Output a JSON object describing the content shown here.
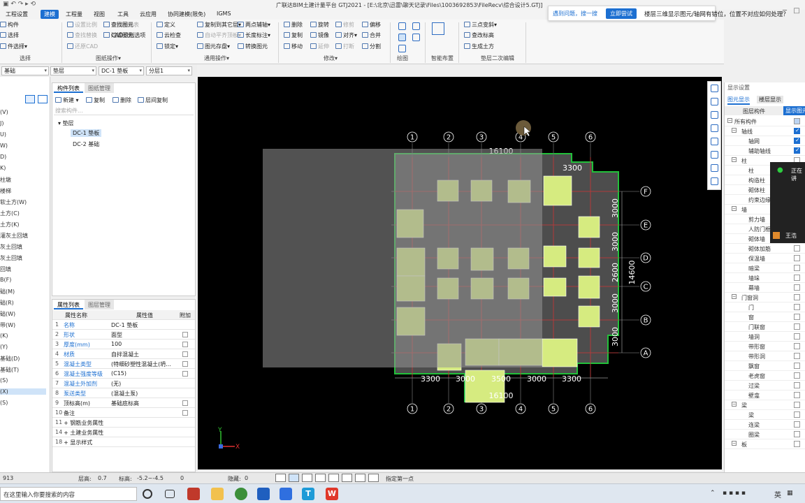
{
  "window": {
    "title": "广联达BIM土建计量平台 GTJ2021 - [E:\\北京\\迅雷\\聊天记录\\Files\\1003692853\\FileRecv\\综合设计5.GTJ]"
  },
  "menu": {
    "items": [
      "工程设置",
      "建模",
      "工程量",
      "视图",
      "工具",
      "云应用",
      "协同建模(限免)",
      "IGMS"
    ],
    "active": "建模"
  },
  "ribbon": {
    "groups": [
      {
        "label": "选择",
        "items": [
          "构件",
          "选择",
          "件选择▾"
        ]
      },
      {
        "label": "图纸操作▾",
        "items": [
          "设置比例",
          "查找替换",
          "还原CAD",
          "识别楼层表",
          "CAD识别选项",
          "查找图元",
          "过滤图元"
        ]
      },
      {
        "label": "通用操作▾",
        "items": [
          "定义",
          "云检查",
          "锁定▾",
          "复制到其它层▾",
          "自动平齐顶板▾",
          "图元存盘▾",
          "两点辅轴▾",
          "长度标注▾",
          "转换图元"
        ]
      },
      {
        "label": "修改▾",
        "items": [
          "删除",
          "复制",
          "移动",
          "旋转",
          "镜像",
          "延伸",
          "修剪",
          "对齐▾",
          "打断",
          "偏移",
          "合并",
          "分割"
        ]
      },
      {
        "label": "绘图",
        "items": []
      },
      {
        "label": "智能布置",
        "items": []
      },
      {
        "label": "垫层二次编辑",
        "items": [
          "三点变斜▾",
          "查改标高",
          "生成土方"
        ]
      }
    ]
  },
  "tip": {
    "question": "遇到问题，搜一搜",
    "button": "立即尝试"
  },
  "help_question": "楼层三维显示图元/轴网有错位，位置不对应如何处理？",
  "selectors": {
    "category": "基础",
    "type": "垫层",
    "component": "DC-1 垫板",
    "layer": "分层1"
  },
  "left_strip": [
    "(V)",
    "J)",
    "U)",
    "W)",
    "D)",
    "K)",
    "柱墩",
    "楼梯",
    "软土方(W)",
    "土方(C)",
    "土方(K)",
    "灌灰土回填",
    "灰土回填",
    "灰土回填",
    "回填",
    "B(F)",
    "础(M)",
    "础(R)",
    "础(W)",
    "带(W)",
    "(K)",
    "(Y)",
    "基础(D)",
    "基础(T)",
    "(S)",
    "(X)",
    "(S)"
  ],
  "component_panel": {
    "tabs": [
      "构件列表",
      "图纸管理"
    ],
    "toolbar": [
      "新建 ▾",
      "复制",
      "删除",
      "层间复制"
    ],
    "search_placeholder": "搜索构件...",
    "tree_root": "垫层",
    "items": [
      {
        "name": "DC-1 垫板",
        "selected": true
      },
      {
        "name": "DC-2 基础",
        "selected": false
      }
    ]
  },
  "property_panel": {
    "tabs": [
      "属性列表",
      "图层管理"
    ],
    "headers": [
      "属性名称",
      "属性值",
      "附加"
    ],
    "rows": [
      {
        "n": "1",
        "k": "名称",
        "v": "DC-1 垫板",
        "blue": true,
        "cb": false
      },
      {
        "n": "2",
        "k": "形状",
        "v": "面型",
        "blue": true,
        "cb": true
      },
      {
        "n": "3",
        "k": "厚度(mm)",
        "v": "100",
        "blue": true,
        "cb": true
      },
      {
        "n": "4",
        "k": "材质",
        "v": "自拌混凝土",
        "blue": true,
        "cb": true
      },
      {
        "n": "5",
        "k": "混凝土类型",
        "v": "(特细砂塑性混凝土(坍...",
        "blue": true,
        "cb": true
      },
      {
        "n": "6",
        "k": "混凝土强度等级",
        "v": "(C15)",
        "blue": true,
        "cb": true
      },
      {
        "n": "7",
        "k": "混凝土外加剂",
        "v": "(无)",
        "blue": true,
        "cb": false
      },
      {
        "n": "8",
        "k": "泵送类型",
        "v": "(混凝土泵)",
        "blue": true,
        "cb": false
      },
      {
        "n": "9",
        "k": "顶标高(m)",
        "v": "基础底标高",
        "blue": false,
        "cb": true
      },
      {
        "n": "10",
        "k": "备注",
        "v": "",
        "blue": false,
        "cb": true
      },
      {
        "n": "11",
        "k": "+ 钢筋业务属性",
        "v": "",
        "blue": false,
        "cb": false
      },
      {
        "n": "14",
        "k": "+ 土建业务属性",
        "v": "",
        "blue": false,
        "cb": false
      },
      {
        "n": "18",
        "k": "+ 显示样式",
        "v": "",
        "blue": false,
        "cb": false
      }
    ]
  },
  "canvas": {
    "axis_numbers": [
      "1",
      "2",
      "3",
      "4",
      "5",
      "6"
    ],
    "axis_letters": [
      "F",
      "E",
      "D",
      "C",
      "B",
      "A"
    ],
    "dims_top": [
      "16100",
      "3300"
    ],
    "dims_bottom": [
      "3300",
      "3000",
      "3500",
      "3000",
      "3300"
    ],
    "dims_bottom_total": "16100",
    "dims_right": [
      "3000",
      "3000",
      "2600",
      "3000",
      "3000"
    ],
    "dims_right_total": "14600",
    "ucs": {
      "x": "X",
      "y": "Y"
    }
  },
  "right_panel": {
    "title": "显示设置",
    "tabs": [
      "图元显示",
      "楼层显示"
    ],
    "headers": [
      "图层构件",
      "显示图元"
    ],
    "rows": [
      {
        "label": "所有构件",
        "indent": 0,
        "group": true,
        "check": "partial"
      },
      {
        "label": "轴线",
        "indent": 1,
        "group": true,
        "check": "on"
      },
      {
        "label": "轴网",
        "indent": 2,
        "group": false,
        "check": "on"
      },
      {
        "label": "辅助轴线",
        "indent": 2,
        "group": false,
        "check": "on"
      },
      {
        "label": "柱",
        "indent": 1,
        "group": true,
        "check": "off"
      },
      {
        "label": "柱",
        "indent": 2,
        "group": false,
        "check": "off"
      },
      {
        "label": "构造柱",
        "indent": 2,
        "group": false,
        "check": "off"
      },
      {
        "label": "砌体柱",
        "indent": 2,
        "group": false,
        "check": "off"
      },
      {
        "label": "约束边缘非...",
        "indent": 2,
        "group": false,
        "check": "off"
      },
      {
        "label": "墙",
        "indent": 1,
        "group": true,
        "check": "off"
      },
      {
        "label": "剪力墙",
        "indent": 2,
        "group": false,
        "check": "off"
      },
      {
        "label": "人防门框墙",
        "indent": 2,
        "group": false,
        "check": "off"
      },
      {
        "label": "砌体墙",
        "indent": 2,
        "group": false,
        "check": "off"
      },
      {
        "label": "砌体加筋",
        "indent": 2,
        "group": false,
        "check": "off"
      },
      {
        "label": "保温墙",
        "indent": 2,
        "group": false,
        "check": "off"
      },
      {
        "label": "暗梁",
        "indent": 2,
        "group": false,
        "check": "off"
      },
      {
        "label": "墙垛",
        "indent": 2,
        "group": false,
        "check": "off"
      },
      {
        "label": "幕墙",
        "indent": 2,
        "group": false,
        "check": "off"
      },
      {
        "label": "门窗洞",
        "indent": 1,
        "group": true,
        "check": "off"
      },
      {
        "label": "门",
        "indent": 2,
        "group": false,
        "check": "off"
      },
      {
        "label": "窗",
        "indent": 2,
        "group": false,
        "check": "off"
      },
      {
        "label": "门联窗",
        "indent": 2,
        "group": false,
        "check": "off"
      },
      {
        "label": "墙洞",
        "indent": 2,
        "group": false,
        "check": "off"
      },
      {
        "label": "带形窗",
        "indent": 2,
        "group": false,
        "check": "off"
      },
      {
        "label": "带形洞",
        "indent": 2,
        "group": false,
        "check": "off"
      },
      {
        "label": "飘窗",
        "indent": 2,
        "group": false,
        "check": "off"
      },
      {
        "label": "老虎窗",
        "indent": 2,
        "group": false,
        "check": "off"
      },
      {
        "label": "过梁",
        "indent": 2,
        "group": false,
        "check": "off"
      },
      {
        "label": "壁龛",
        "indent": 2,
        "group": false,
        "check": "off"
      },
      {
        "label": "梁",
        "indent": 1,
        "group": true,
        "check": "off"
      },
      {
        "label": "梁",
        "indent": 2,
        "group": false,
        "check": "off"
      },
      {
        "label": "连梁",
        "indent": 2,
        "group": false,
        "check": "off"
      },
      {
        "label": "圈梁",
        "indent": 2,
        "group": false,
        "check": "off"
      },
      {
        "label": "板",
        "indent": 1,
        "group": true,
        "check": "off"
      }
    ]
  },
  "video": {
    "label": "正在讲",
    "name": "王浩"
  },
  "status": {
    "coord": "913",
    "floor_h_label": "层高:",
    "floor_h": "0.7",
    "elev_label": "标高:",
    "elev": "-5.2~-4.5",
    "val": "0",
    "hidden_label": "隐藏:",
    "hidden": "0",
    "prompt": "指定第一点"
  },
  "taskbar": {
    "search": "在这里输入你要搜索的内容",
    "ime": "英"
  },
  "colors": {
    "accent": "#1c6fd1",
    "pad_fill": "#d6eb80",
    "slab_fill": "#4d4d4d",
    "axis": "#ffffff",
    "grid_red": "#c93030",
    "outline_green": "#22c03a"
  }
}
